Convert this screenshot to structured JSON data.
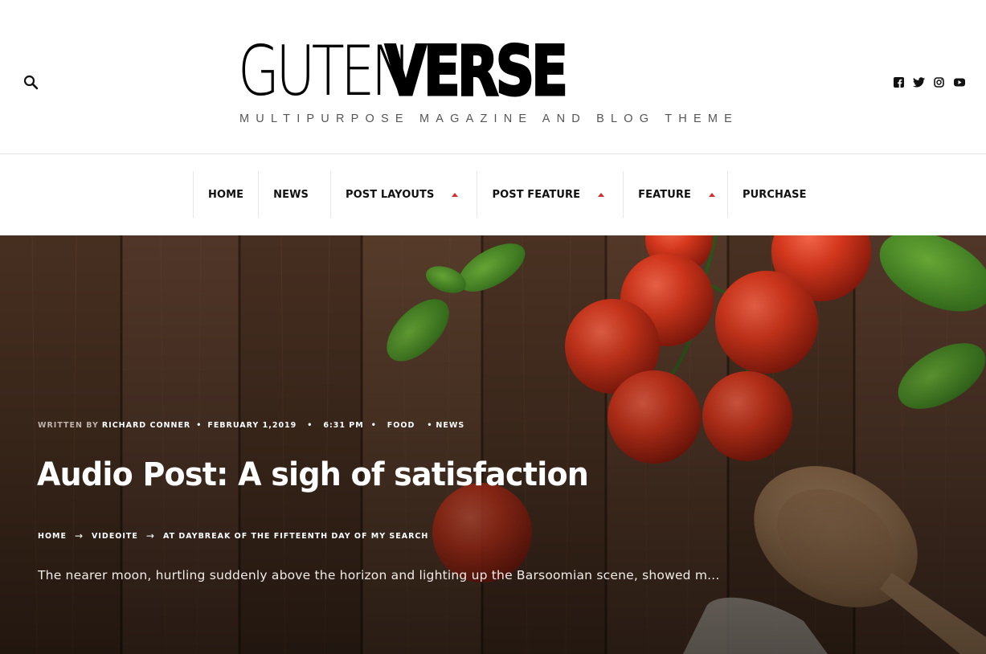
{
  "header": {
    "logo_light": "GUTEN",
    "logo_bold": "VERSE",
    "tagline": "MULTIPURPOSE MAGAZINE AND BLOG THEME",
    "search_icon": "search-icon",
    "socials": [
      {
        "icon": "facebook-icon"
      },
      {
        "icon": "twitter-icon"
      },
      {
        "icon": "instagram-icon"
      },
      {
        "icon": "youtube-icon"
      }
    ]
  },
  "nav": {
    "items": [
      {
        "label": "HOME",
        "has_dropdown": false
      },
      {
        "label": "NEWS",
        "has_dropdown": false
      },
      {
        "label": "POST LAYOUTS",
        "has_dropdown": true
      },
      {
        "label": "POST FEATURE",
        "has_dropdown": true
      },
      {
        "label": "FEATURE",
        "has_dropdown": true
      },
      {
        "label": "PURCHASE",
        "has_dropdown": false
      }
    ],
    "accent_color": "#d32f2f"
  },
  "hero": {
    "meta": {
      "written_by_label": "WRITTEN BY",
      "author": "RICHARD CONNER",
      "date": "FEBRUARY 1,2019",
      "time": "6:31 PM",
      "category_1": "FOOD",
      "category_2": "NEWS"
    },
    "title": "Audio Post: A sigh of satisfaction",
    "breadcrumb": {
      "home": "HOME",
      "section": "VIDEOITE",
      "current": "AT DAYBREAK OF THE FIFTEENTH DAY OF MY SEARCH"
    },
    "excerpt": "The nearer moon, hurtling suddenly above the horizon and lighting up the Barsoomian scene, showed m..."
  }
}
